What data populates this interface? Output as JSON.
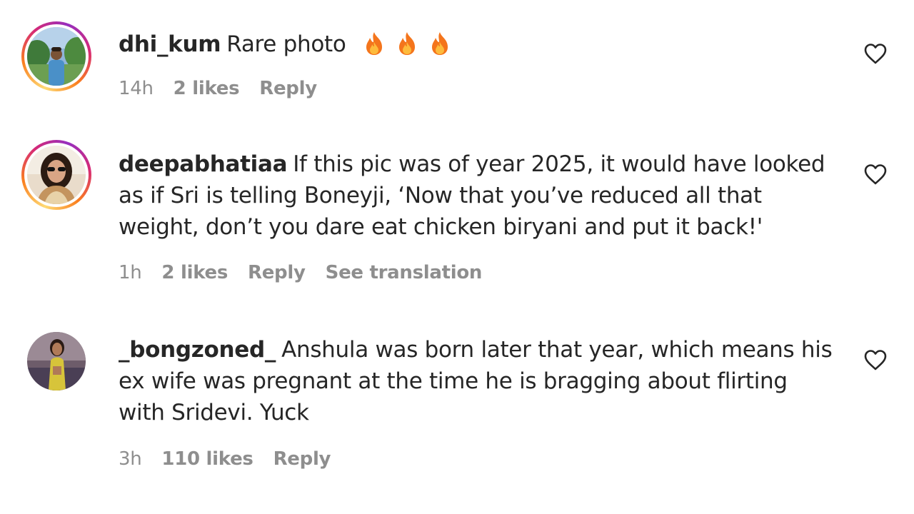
{
  "comments": [
    {
      "username": "dhi_kum",
      "text": "Rare photo",
      "emoji": [
        "fire-emoji",
        "fire-emoji",
        "fire-emoji"
      ],
      "time": "14h",
      "likes": "2 likes",
      "reply": "Reply",
      "translation": ""
    },
    {
      "username": "deepabhatiaa",
      "text": "If this pic was of year 2025, it would have looked as if Sri is telling Boneyji, ‘Now that you’ve reduced all that weight, don’t you dare eat chicken biryani and put it back!'",
      "time": "1h",
      "likes": "2 likes",
      "reply": "Reply",
      "translation": "See translation"
    },
    {
      "username": "_bongzoned_",
      "text": "Anshula was born later that year, which means his ex wife was pregnant at the time he is bragging about flirting with Sridevi. Yuck",
      "time": "3h",
      "likes": "110 likes",
      "reply": "Reply",
      "translation": ""
    }
  ],
  "icons": {
    "like": "heart-outline-icon",
    "emoji": "fire-emoji"
  },
  "colors": {
    "text": "#262626",
    "meta": "#8e8e8e",
    "story_ring_start": "#feda75",
    "story_ring_end": "#d62976"
  }
}
